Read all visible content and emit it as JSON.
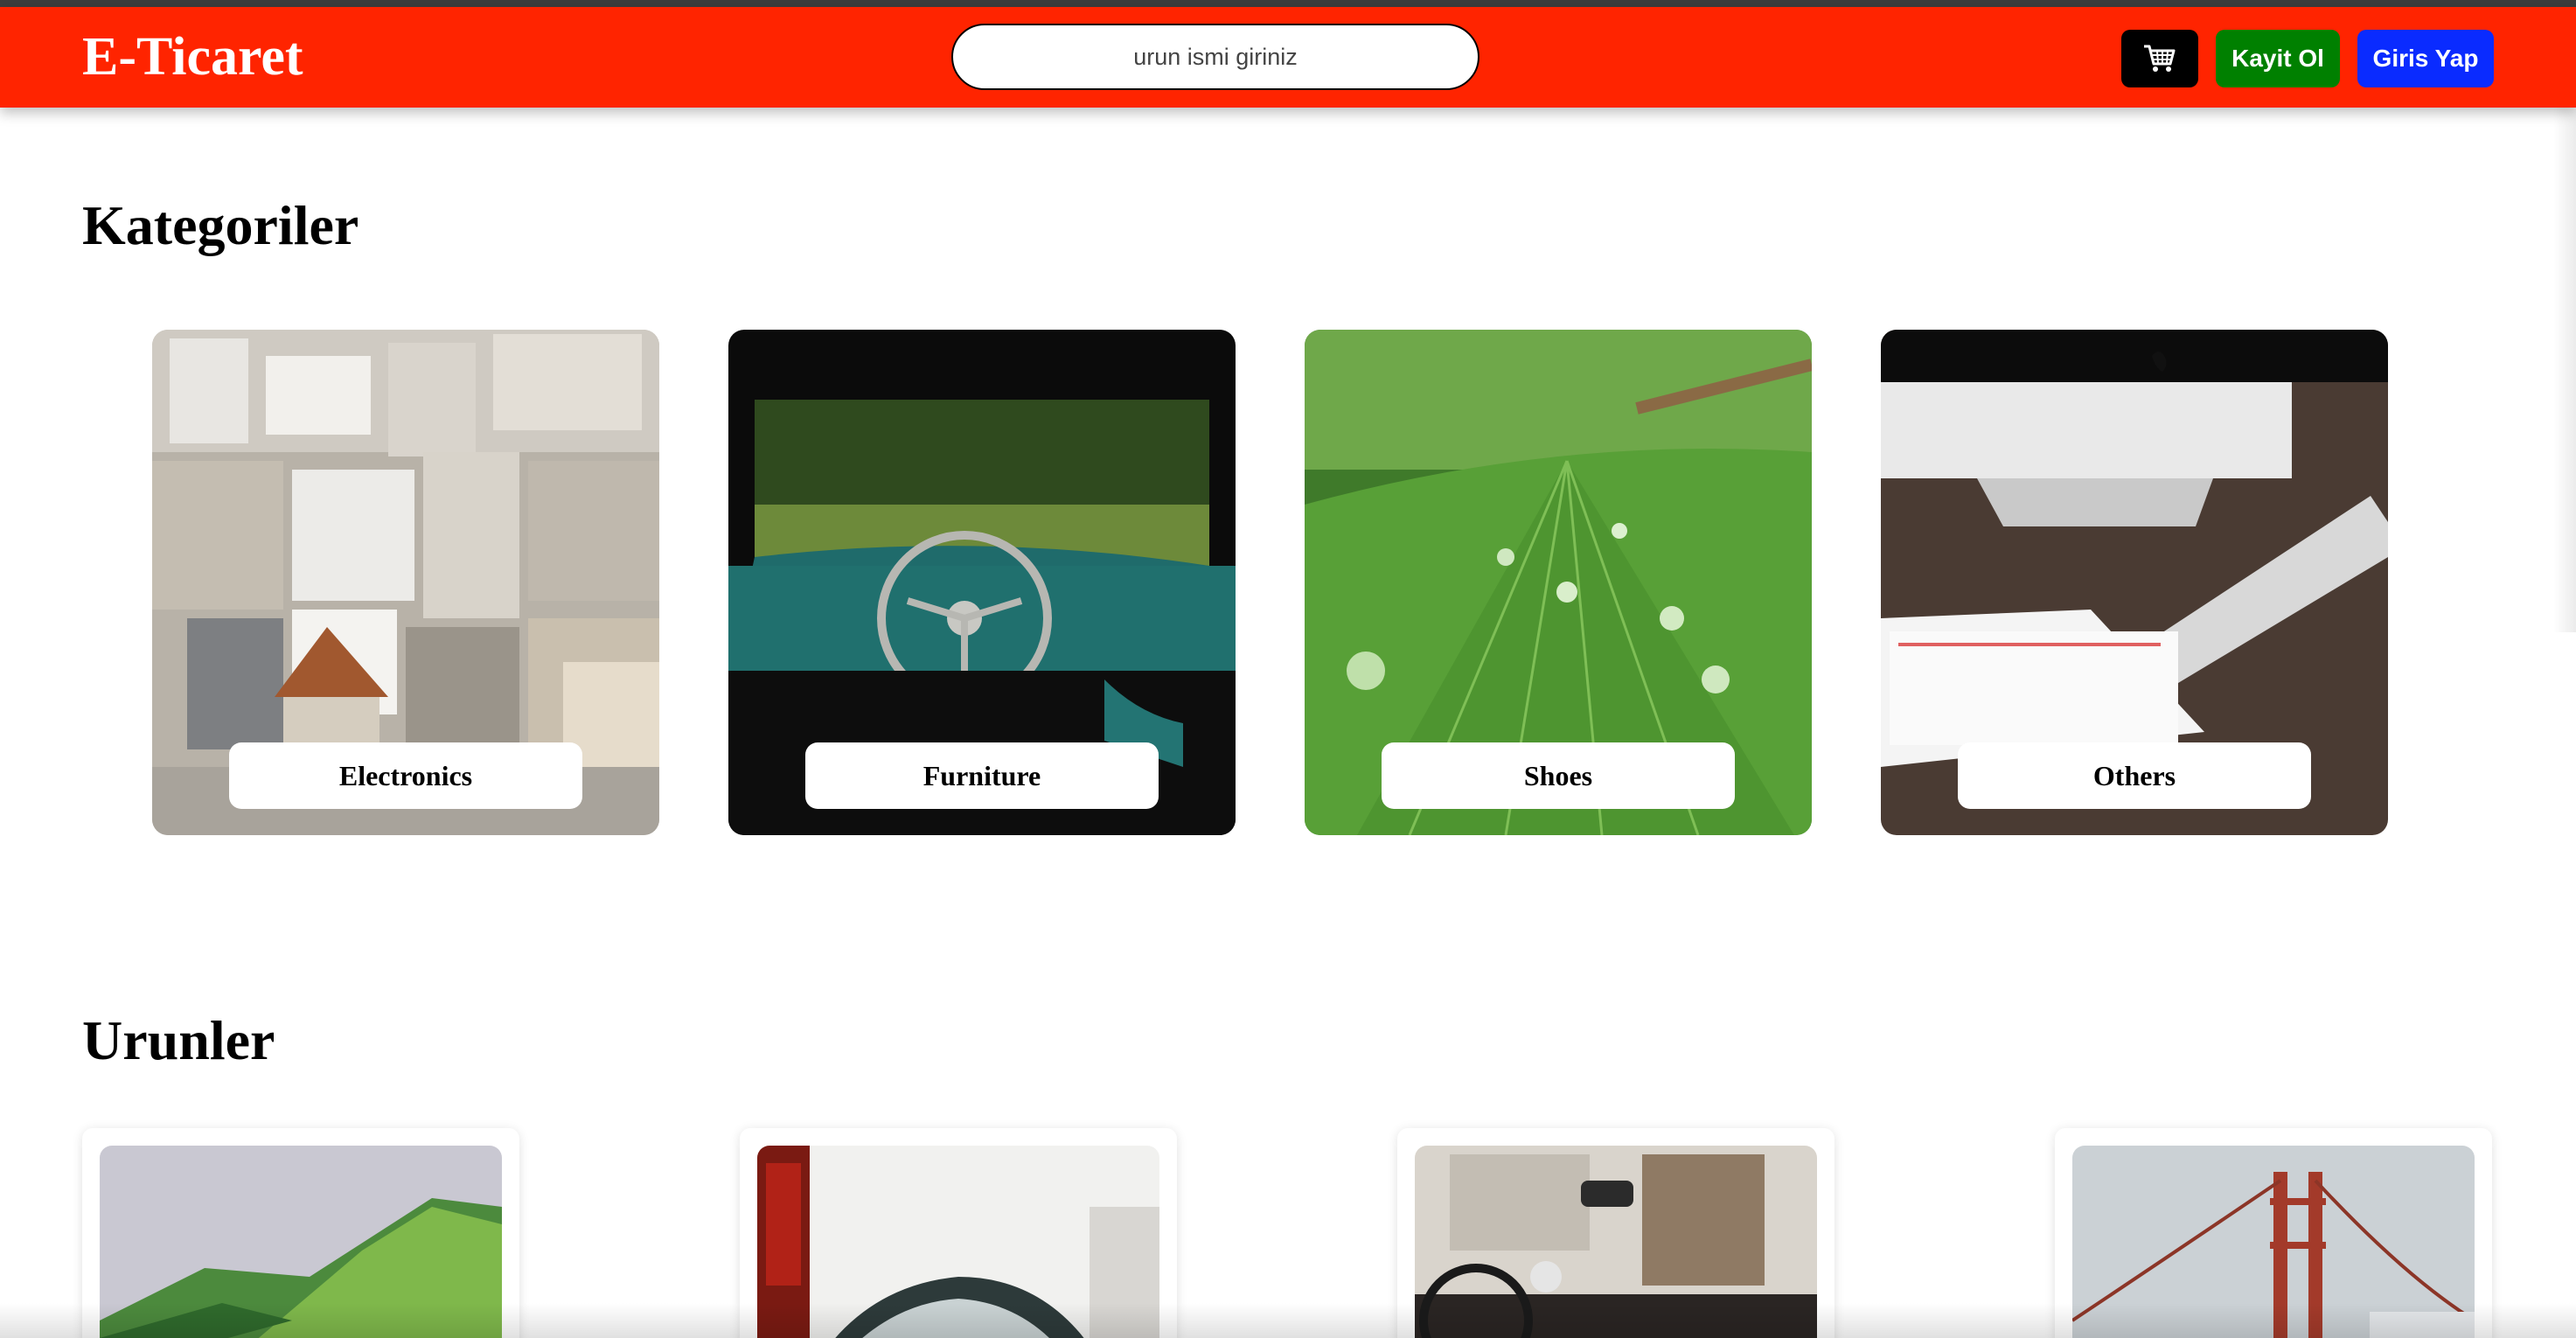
{
  "header": {
    "brand": "E-Ticaret",
    "search_placeholder": "urun ismi giriniz",
    "cart_icon": "cart-icon",
    "register_label": "Kayit Ol",
    "login_label": "Giris Yap",
    "colors": {
      "navbar": "#ff2400",
      "cart_button": "#000000",
      "register_button": "#008000",
      "login_button": "#0a2bff"
    }
  },
  "categories": {
    "title": "Kategoriler",
    "items": [
      {
        "label": "Electronics",
        "image": "city-rooftops-photo"
      },
      {
        "label": "Furniture",
        "image": "vintage-car-dashboard-photo"
      },
      {
        "label": "Shoes",
        "image": "green-leaf-water-drops-photo"
      },
      {
        "label": "Others",
        "image": "desk-imac-keyboard-tablet-photo"
      }
    ]
  },
  "products": {
    "title": "Urunler",
    "items": [
      {
        "image": "green-mountain-photo"
      },
      {
        "image": "street-car-photo"
      },
      {
        "image": "car-interior-photo"
      },
      {
        "image": "golden-gate-bridge-photo"
      }
    ]
  }
}
